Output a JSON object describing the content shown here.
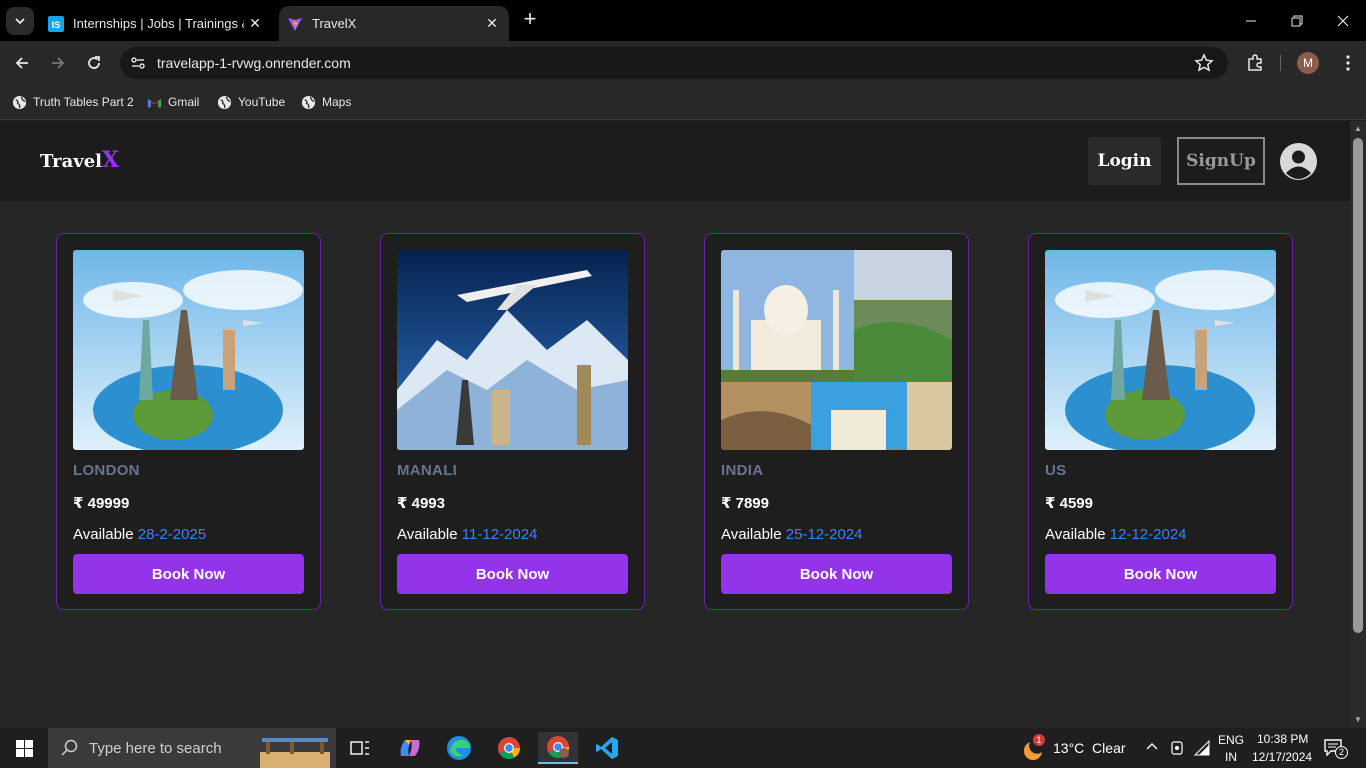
{
  "browser": {
    "tabs": [
      {
        "title": "Internships | Jobs | Trainings & I",
        "favicon": "internshala-icon"
      },
      {
        "title": "TravelX",
        "favicon": "vite-icon"
      }
    ],
    "url": "travelapp-1-rvwg.onrender.com",
    "profile_initial": "M",
    "bookmarks": [
      {
        "label": "Truth Tables Part 2",
        "icon": "globe-icon"
      },
      {
        "label": "Gmail",
        "icon": "gmail-icon"
      },
      {
        "label": "YouTube",
        "icon": "globe-icon"
      },
      {
        "label": "Maps",
        "icon": "globe-icon"
      }
    ]
  },
  "site": {
    "brand_main": "Travel",
    "brand_accent": "X",
    "login_label": "Login",
    "signup_label": "SignUp",
    "accent_color": "#9333ea"
  },
  "destinations": [
    {
      "city": "LONDON",
      "price": "₹ 49999",
      "available_label": "Available",
      "date": "28-2-2025",
      "button": "Book Now"
    },
    {
      "city": "MANALI",
      "price": "₹ 4993",
      "available_label": "Available",
      "date": "11-12-2024",
      "button": "Book Now"
    },
    {
      "city": "INDIA",
      "price": "₹ 7899",
      "available_label": "Available",
      "date": "25-12-2024",
      "button": "Book Now"
    },
    {
      "city": "US",
      "price": "₹ 4599",
      "available_label": "Available",
      "date": "12-12-2024",
      "button": "Book Now"
    }
  ],
  "taskbar": {
    "search_placeholder": "Type here to search",
    "weather": "13°C  Clear",
    "weather_badge": "1",
    "lang_top": "ENG",
    "lang_bottom": "IN",
    "time": "10:38 PM",
    "date": "12/17/2024",
    "notifications": "2"
  }
}
